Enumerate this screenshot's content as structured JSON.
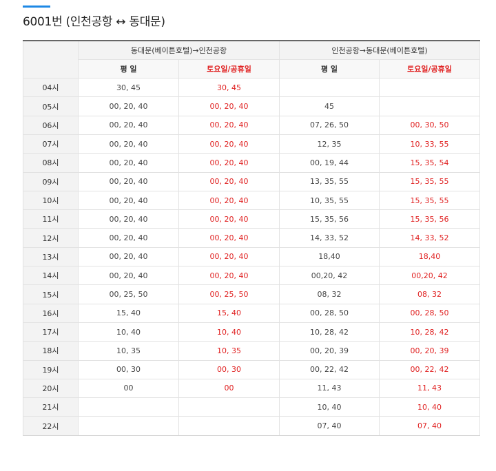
{
  "page": {
    "title": "6001번 (인천공항 ↔ 동대문)"
  },
  "colors": {
    "accent": "#1e88e5",
    "weekend_text": "#e02020",
    "header_bg": "#f3f3f3"
  },
  "table": {
    "groups": [
      "동대문(베이튼호텔)→인천공항",
      "인천공항→동대문(베이튼호텔)"
    ],
    "subheaders": {
      "weekday": "평 일",
      "weekend": "토요일/공휴일"
    },
    "rows": [
      {
        "hour": "04시",
        "c1": "30, 45",
        "c2": "30, 45",
        "c3": "",
        "c4": ""
      },
      {
        "hour": "05시",
        "c1": "00, 20, 40",
        "c2": "00, 20, 40",
        "c3": "45",
        "c4": ""
      },
      {
        "hour": "06시",
        "c1": "00, 20, 40",
        "c2": "00, 20, 40",
        "c3": "07, 26, 50",
        "c4": "00, 30, 50"
      },
      {
        "hour": "07시",
        "c1": "00, 20, 40",
        "c2": "00, 20, 40",
        "c3": "12, 35",
        "c4": "10, 33, 55"
      },
      {
        "hour": "08시",
        "c1": "00, 20, 40",
        "c2": "00, 20, 40",
        "c3": "00, 19, 44",
        "c4": "15, 35, 54"
      },
      {
        "hour": "09시",
        "c1": "00, 20, 40",
        "c2": "00, 20, 40",
        "c3": "13, 35, 55",
        "c4": "15, 35, 55"
      },
      {
        "hour": "10시",
        "c1": "00, 20, 40",
        "c2": "00, 20, 40",
        "c3": "10, 35, 55",
        "c4": "15, 35, 55"
      },
      {
        "hour": "11시",
        "c1": "00, 20, 40",
        "c2": "00, 20, 40",
        "c3": "15, 35, 56",
        "c4": "15, 35, 56"
      },
      {
        "hour": "12시",
        "c1": "00, 20, 40",
        "c2": "00, 20, 40",
        "c3": "14, 33, 52",
        "c4": "14, 33, 52"
      },
      {
        "hour": "13시",
        "c1": "00, 20, 40",
        "c2": "00, 20, 40",
        "c3": "18,40",
        "c4": "18,40"
      },
      {
        "hour": "14시",
        "c1": "00, 20, 40",
        "c2": "00, 20, 40",
        "c3": "00,20, 42",
        "c4": "00,20, 42"
      },
      {
        "hour": "15시",
        "c1": "00, 25, 50",
        "c2": "00, 25, 50",
        "c3": "08, 32",
        "c4": "08, 32"
      },
      {
        "hour": "16시",
        "c1": "15, 40",
        "c2": "15, 40",
        "c3": "00, 28, 50",
        "c4": "00, 28, 50"
      },
      {
        "hour": "17시",
        "c1": "10, 40",
        "c2": "10, 40",
        "c3": "10, 28, 42",
        "c4": "10, 28, 42"
      },
      {
        "hour": "18시",
        "c1": "10, 35",
        "c2": "10, 35",
        "c3": "00, 20, 39",
        "c4": "00, 20, 39"
      },
      {
        "hour": "19시",
        "c1": "00, 30",
        "c2": "00, 30",
        "c3": "00, 22, 42",
        "c4": "00, 22, 42"
      },
      {
        "hour": "20시",
        "c1": "00",
        "c2": "00",
        "c3": "11, 43",
        "c4": "11, 43"
      },
      {
        "hour": "21시",
        "c1": "",
        "c2": "",
        "c3": "10, 40",
        "c4": "10, 40"
      },
      {
        "hour": "22시",
        "c1": "",
        "c2": "",
        "c3": "07, 40",
        "c4": "07, 40"
      }
    ]
  }
}
